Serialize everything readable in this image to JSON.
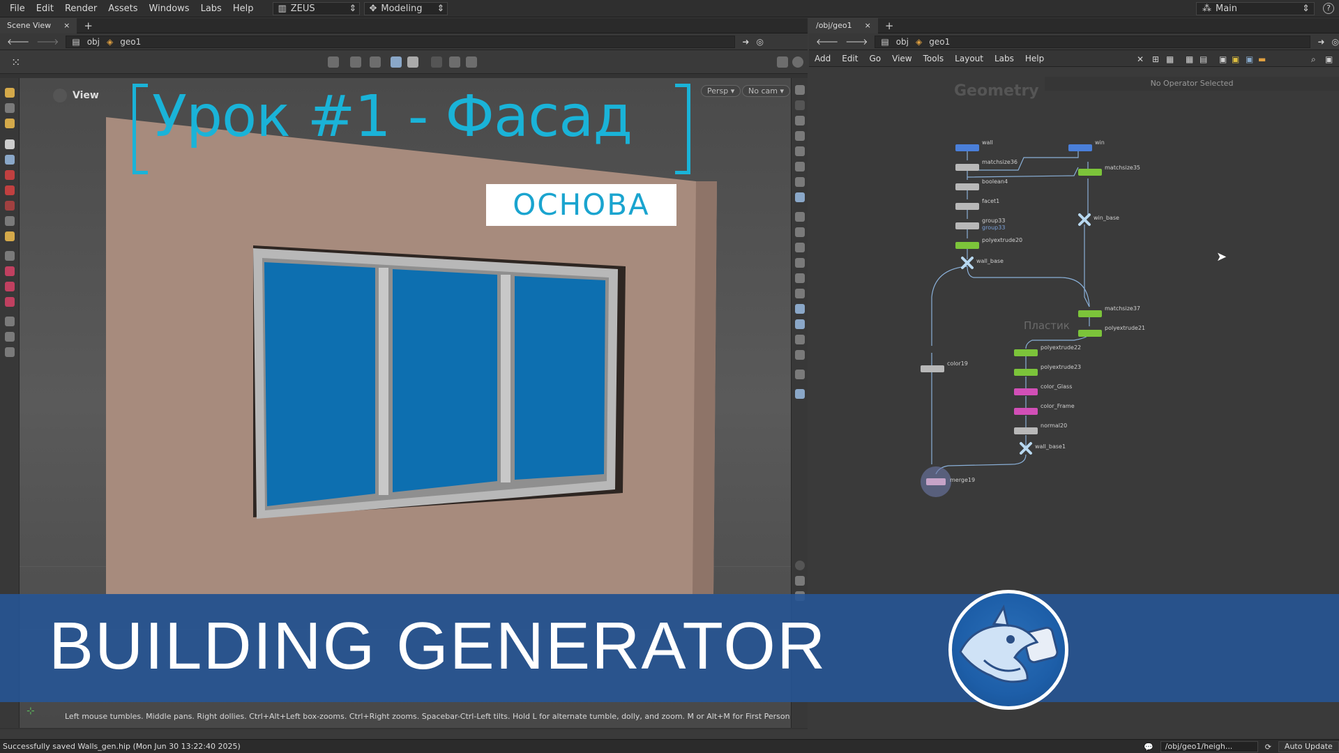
{
  "menubar": {
    "items": [
      "File",
      "Edit",
      "Render",
      "Assets",
      "Windows",
      "Labs",
      "Help"
    ],
    "desktop": "ZEUS",
    "mode": "Modeling",
    "right_desktop": "Main"
  },
  "left": {
    "tab": "Scene View",
    "path": [
      "obj",
      "geo1"
    ],
    "view_label": "View",
    "persp": "Persp",
    "cam": "No cam",
    "lesson_title": "Урок #1 - Фасад",
    "lesson_sub": "ОСНОВА",
    "hint": "Left mouse tumbles. Middle pans. Right dollies. Ctrl+Alt+Left box-zooms. Ctrl+Right zooms. Spacebar-Ctrl-Left tilts. Hold L for alternate tumble, dolly, and zoom. M or Alt+M for First Person Navigation."
  },
  "right": {
    "tab": "/obj/geo1",
    "path": [
      "obj",
      "geo1"
    ],
    "menu": [
      "Add",
      "Edit",
      "Go",
      "View",
      "Tools",
      "Layout",
      "Labs",
      "Help"
    ],
    "context_title": "Geometry",
    "no_op": "No Operator Selected",
    "group_label": "Пластик",
    "nodes": {
      "wall": "wall",
      "win": "win",
      "matchsize36": "matchsize36",
      "matchsize35": "matchsize35",
      "boolean4": "boolean4",
      "facet1": "facet1",
      "group33": "group33",
      "group33_sub": "group33",
      "polyextrude20": "polyextrude20",
      "wall_base": "wall_base",
      "win_base": "win_base",
      "matchsize37": "matchsize37",
      "polyextrude21": "polyextrude21",
      "polyextrude22": "polyextrude22",
      "polyextrude23": "polyextrude23",
      "color19": "color19",
      "color_glass": "color_Glass",
      "color_frame": "color_Frame",
      "normal20": "normal20",
      "wall_base1": "wall_base1",
      "merge19": "merge19"
    }
  },
  "banner": {
    "title": "BUILDING GENERATOR"
  },
  "status": {
    "message": "Successfully saved Walls_gen.hip (Mon Jun 30 13:22:40 2025)",
    "path": "/obj/geo1/heigh...",
    "auto_update": "Auto Update"
  },
  "colors": {
    "accent_cyan": "#1ab3d8",
    "banner_blue": "#2d5a96",
    "glass_blue": "#0d6fb0",
    "node_blue": "#4a7fd9",
    "node_green": "#7cc43a",
    "node_pink": "#d24fb7",
    "node_gray": "#b8b8b8"
  }
}
